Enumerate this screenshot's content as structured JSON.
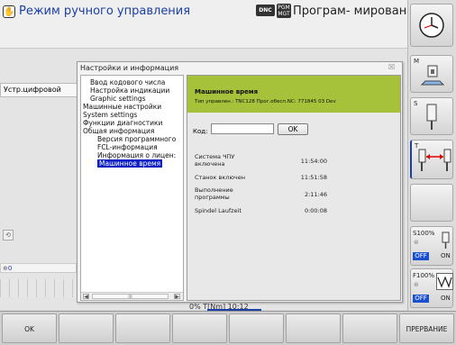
{
  "header": {
    "mode_left": "Режим ручного управления",
    "dnc_badge": "DNC",
    "pgm_badge_line1": "PGM",
    "pgm_badge_line2": "MGT",
    "mode_right": "Програм- мирован..."
  },
  "background": {
    "display_label": "Устр.цифровой",
    "axis_value": "0",
    "status_fragment": "0% T[Nm] 10:12"
  },
  "dialog": {
    "title": "Настройки и информация",
    "close_glyph": "☒",
    "tree": [
      {
        "label": "Ввод кодового числа",
        "prefix": "",
        "selected": false,
        "level": 1
      },
      {
        "label": "Настройка индикации",
        "prefix": "",
        "selected": false,
        "level": 1
      },
      {
        "label": "Graphic settings",
        "prefix": "",
        "selected": false,
        "level": 1
      },
      {
        "label": "Машинные настройки",
        "prefix": "⊞",
        "selected": false,
        "level": 0
      },
      {
        "label": "System settings",
        "prefix": "⊞",
        "selected": false,
        "level": 0
      },
      {
        "label": "Функции диагностики",
        "prefix": "⊞",
        "selected": false,
        "level": 0
      },
      {
        "label": "Общая информация",
        "prefix": "⊟",
        "selected": false,
        "level": 0
      },
      {
        "label": "Версия программного",
        "prefix": "",
        "selected": false,
        "level": 2
      },
      {
        "label": "FCL-информация",
        "prefix": "",
        "selected": false,
        "level": 2
      },
      {
        "label": "Информация о лицен:",
        "prefix": "",
        "selected": false,
        "level": 2
      },
      {
        "label": "Машинное время",
        "prefix": "",
        "selected": true,
        "level": 2
      }
    ],
    "scroll_left": "◀",
    "scroll_right": "▶",
    "scroll_thumb": "III",
    "banner_title": "Машинное время",
    "banner_info": "Тип управлен.: TNC128 Прог.обесп.NC: 771845 03 Dev",
    "code_label": "Код:",
    "code_value": "",
    "ok_label": "OK",
    "rows": [
      {
        "label1": "Система ЧПУ",
        "label2": "включена",
        "value": "11:54:00"
      },
      {
        "label1": "Станок включен",
        "label2": "",
        "value": "11:51:58"
      },
      {
        "label1": "Выполнение",
        "label2": "программы",
        "value": "2:11:46"
      },
      {
        "label1": "Spindel Laufzeit",
        "label2": "",
        "value": "0:00:08"
      }
    ]
  },
  "right_softkeys": {
    "m_label": "M",
    "s_label": "S",
    "t_label": "T",
    "s_override": "S100%",
    "f_override": "F100%",
    "off1": "OFF",
    "on1": "ON",
    "off2": "OFF",
    "on2": "ON"
  },
  "bottom_softkeys": {
    "ok": "OK",
    "interrupt": "ПРЕРВАНИЕ"
  },
  "colors": {
    "accent_blue": "#1a3fa6",
    "banner_green": "#a6c23a",
    "selection_blue": "#0a1fc4",
    "off_blue": "#1a4fd0"
  }
}
